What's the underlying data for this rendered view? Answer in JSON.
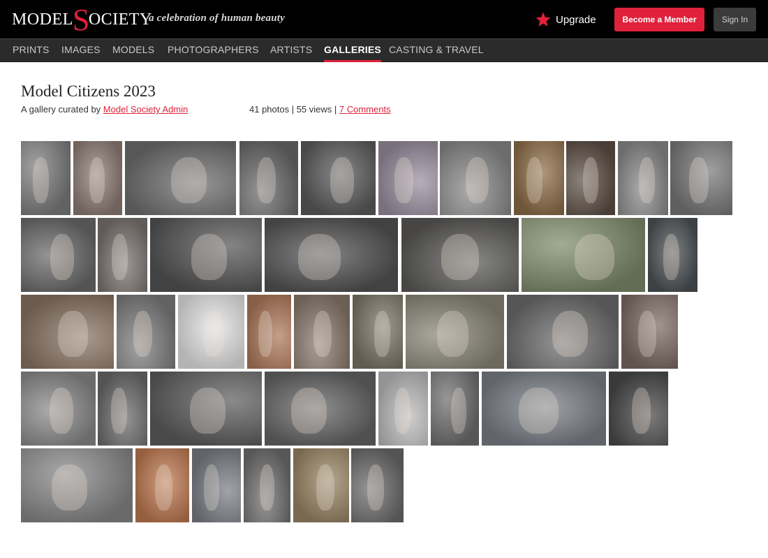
{
  "header": {
    "logo_left": "MODEL",
    "logo_s": "S",
    "logo_right": "OCIETY",
    "tagline": "a celebration of human beauty",
    "upgrade_label": "Upgrade",
    "upgrade_icon": "star-icon",
    "member_button": "Become a Member",
    "signin_button": "Sign In"
  },
  "nav": {
    "items": [
      {
        "label": "PRINTS"
      },
      {
        "label": "IMAGES"
      },
      {
        "label": "MODELS"
      },
      {
        "label": "PHOTOGRAPHERS"
      },
      {
        "label": "ARTISTS"
      },
      {
        "label": "GALLERIES"
      },
      {
        "label": "CASTING & TRAVEL"
      }
    ],
    "active": "GALLERIES"
  },
  "gallery": {
    "title": "Model Citizens 2023",
    "curated_prefix": "A gallery curated by ",
    "curator": "Model Society Admin",
    "stats_text": "41 photos | 55 views | ",
    "comments_link": "7 Comments"
  },
  "colors": {
    "accent": "#e0213b",
    "header_bg": "#000000",
    "nav_bg": "#2b2b2b"
  },
  "photos": {
    "tones": [
      "#7d7d7d",
      "#8e7f76",
      "#6f6f6f",
      "#6a6a6a",
      "#5c5c5c",
      "#9b8fa0",
      "#8b8b8b",
      "#8e6e4a",
      "#5e5147",
      "#8c8c8c",
      "#7a7a7a",
      "#6b6b6b",
      "#7b7470",
      "#555555",
      "#545454",
      "#5b5a58",
      "#7f8b6c",
      "#4f5356",
      "#8a7564",
      "#7e7e7e",
      "#e6e6e6",
      "#b07a5c",
      "#8b7a6e",
      "#7c7566",
      "#8a8677",
      "#6e6e6e",
      "#7c6a64",
      "#8b8b8b",
      "#6c6c6c",
      "#5e5e5e",
      "#666666",
      "#bdbdbd",
      "#6f6f6f",
      "#7c8088",
      "#4a4a4a",
      "#888888",
      "#c07a52",
      "#7b7f86",
      "#707070",
      "#9a8666",
      "#6c6c6c"
    ]
  }
}
